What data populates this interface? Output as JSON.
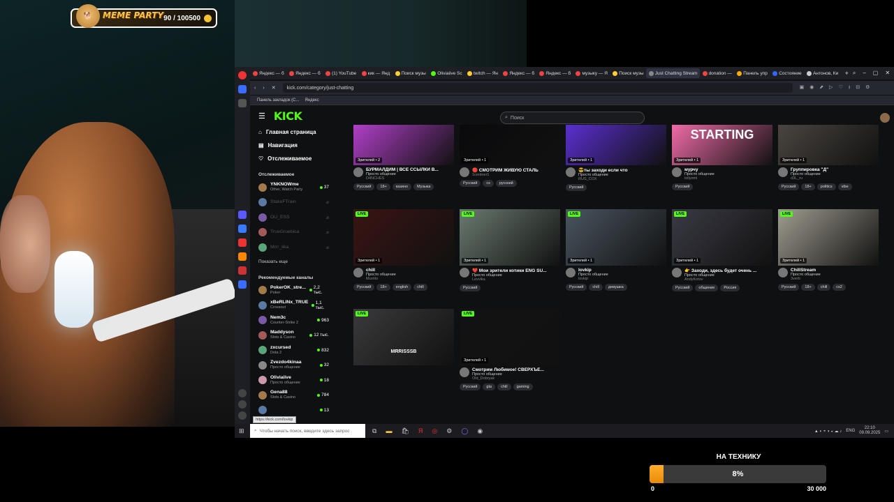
{
  "overlay": {
    "meme_title": "MEME PARTY",
    "meme_count": "90 / 100500"
  },
  "browser": {
    "tabs": [
      {
        "label": "Яндекс — б"
      },
      {
        "label": "Яндекс — б"
      },
      {
        "label": "(1) YouTube"
      },
      {
        "label": "кик — Янд"
      },
      {
        "label": "Поиск музы"
      },
      {
        "label": "Oliviaiive Sc"
      },
      {
        "label": "twitch — Ян"
      },
      {
        "label": "Яндекс — б"
      },
      {
        "label": "Яндекс — б"
      },
      {
        "label": "музыку — Я"
      },
      {
        "label": "Поиск музы"
      },
      {
        "label": "Just Chatting Stream"
      },
      {
        "label": "donation —"
      },
      {
        "label": "Панель упр"
      },
      {
        "label": "Состояние"
      },
      {
        "label": "Антонов, Ки"
      }
    ],
    "url": "kick.com/category/just-chatting",
    "bookmarks": [
      "Панель закладок (С...",
      "Яндекс"
    ]
  },
  "kick": {
    "search_placeholder": "Поиск",
    "nav": [
      {
        "label": "Главная страница"
      },
      {
        "label": "Навигация"
      },
      {
        "label": "Отслеживаемое"
      }
    ],
    "followed_title": "Отслеживаемое",
    "followed": [
      {
        "name": "YNKNOWme",
        "category": "Other, Watch Party",
        "viewers": "37",
        "online": true
      },
      {
        "name": "StakeFTrain",
        "category": "",
        "viewers": "",
        "online": false
      },
      {
        "name": "OU_ESS",
        "category": "",
        "viewers": "",
        "online": false
      },
      {
        "name": "TrueGruebica",
        "category": "",
        "viewers": "",
        "online": false
      },
      {
        "name": "Mrrr_lika",
        "category": "",
        "viewers": "",
        "online": false
      }
    ],
    "show_more": "Показать еще",
    "recommended_title": "Рекомендуемые каналы",
    "recommended": [
      {
        "name": "PokerOK_stre...",
        "category": "Poker",
        "viewers": "2,2 тыс."
      },
      {
        "name": "xBeRLINx_TRUE",
        "category": "Crossout",
        "viewers": "1,1 тыс."
      },
      {
        "name": "Nem3c",
        "category": "Counter-Strike 2",
        "viewers": "963"
      },
      {
        "name": "Maddyson",
        "category": "Slots & Casino",
        "viewers": "12 тыс."
      },
      {
        "name": "zxcursed",
        "category": "Dota 2",
        "viewers": "832"
      },
      {
        "name": "Zvezdo4kinaa",
        "category": "Просто общение",
        "viewers": "32"
      },
      {
        "name": "Oliviaiive",
        "category": "Просто общение",
        "viewers": "18"
      },
      {
        "name": "Gena88",
        "category": "Slots & Casino",
        "viewers": "784"
      },
      {
        "name": "",
        "category": "",
        "viewers": "13"
      }
    ],
    "streams": [
      {
        "title": "БУРМАЛДИМ | ВСЕ ССЫЛКИ В...",
        "category": "Просто общение",
        "streamer": "D4NCHES",
        "viewers": "Зрителей • 2",
        "live": false,
        "tags": [
          "Русский",
          "18+",
          "казино",
          "Музыка"
        ],
        "thumb": "#b03fc8"
      },
      {
        "title": "🔴 СМОТРИМ ЖИВУЮ СТАЛЬ",
        "category": "",
        "streamer": "1centner1",
        "viewers": "Зрителей • 1",
        "live": false,
        "tags": [
          "Русский",
          "cs",
          "русский"
        ],
        "thumb": "#0a0a0c"
      },
      {
        "title": "😎ты заходи если что",
        "category": "Просто общение",
        "streamer": "RUS_COX",
        "viewers": "Зрителей • 1",
        "live": false,
        "tags": [
          "Русский"
        ],
        "thumb": "#5a2fd0"
      },
      {
        "title": "мурчу",
        "category": "Просто общение",
        "streamer": "lollyomi",
        "viewers": "Зрителей • 1",
        "live": false,
        "tags": [
          "Русский"
        ],
        "thumb": "#f06ba8",
        "overlay_text": "STARTING"
      },
      {
        "title": "Группировка \"Д\"",
        "category": "Просто общение",
        "streamer": "d3L_ru",
        "viewers": "Зрителей • 1",
        "live": false,
        "tags": [
          "Русский",
          "18+",
          "politics",
          "vibe"
        ],
        "thumb": "#4a4540"
      },
      {
        "title": "chill",
        "category": "Просто общение",
        "streamer": "Murrito",
        "viewers": "Зрителей • 1",
        "live": true,
        "tags": [
          "Русский",
          "18+",
          "english",
          "chill"
        ],
        "thumb": "#3a1412"
      },
      {
        "title": "❤️ Мои зрители котики ENG SU...",
        "category": "Просто общение",
        "streamer": "Levvika",
        "viewers": "Зрителей • 1",
        "live": true,
        "tags": [
          "Русский"
        ],
        "thumb": "#6a7a70"
      },
      {
        "title": "lovkip",
        "category": "Просто общение",
        "streamer": "lovkip",
        "viewers": "Зрителей • 1",
        "live": true,
        "tags": [
          "Русский",
          "chill",
          "девушка"
        ],
        "thumb": "#4a5560"
      },
      {
        "title": "👉 Заходи, здесь будет очень ...",
        "category": "Просто общение",
        "streamer": "AndyKotov",
        "viewers": "Зрителей • 1",
        "live": true,
        "tags": [
          "Русский",
          "общение",
          "Россия"
        ],
        "thumb": "#3a3a44"
      },
      {
        "title": "ChillStream",
        "category": "Просто общение",
        "streamer": "3verb",
        "viewers": "Зрителей • 1",
        "live": true,
        "tags": [
          "Русский",
          "18+",
          "chill",
          "cs2"
        ],
        "thumb": "#a09d90"
      },
      {
        "title": "",
        "category": "",
        "streamer": "",
        "viewers": "",
        "live": true,
        "tags": [],
        "thumb": "#3a3a3c",
        "overlay_text": "MRRISSSB"
      },
      {
        "title": "Смотрим Любимое! СВЕРХЪЕ...",
        "category": "Просто общение",
        "streamer": "Old_Dobryak",
        "viewers": "Зрителей • 1",
        "live": true,
        "tags": [
          "Русский",
          "gta",
          "chill",
          "gaming"
        ],
        "thumb": "#121214"
      }
    ]
  },
  "taskbar": {
    "search_placeholder": "Чтобы начать поиск, введите здесь запрос",
    "lang": "ENG",
    "time": "22:10",
    "date": "09.09.2025"
  },
  "tooltip_url": "https://kick.com/lovkip",
  "goal": {
    "title": "НА ТЕХНИКУ",
    "percent_label": "8%",
    "progress": 0.08,
    "min_label": "0",
    "max_label": "30 000"
  }
}
